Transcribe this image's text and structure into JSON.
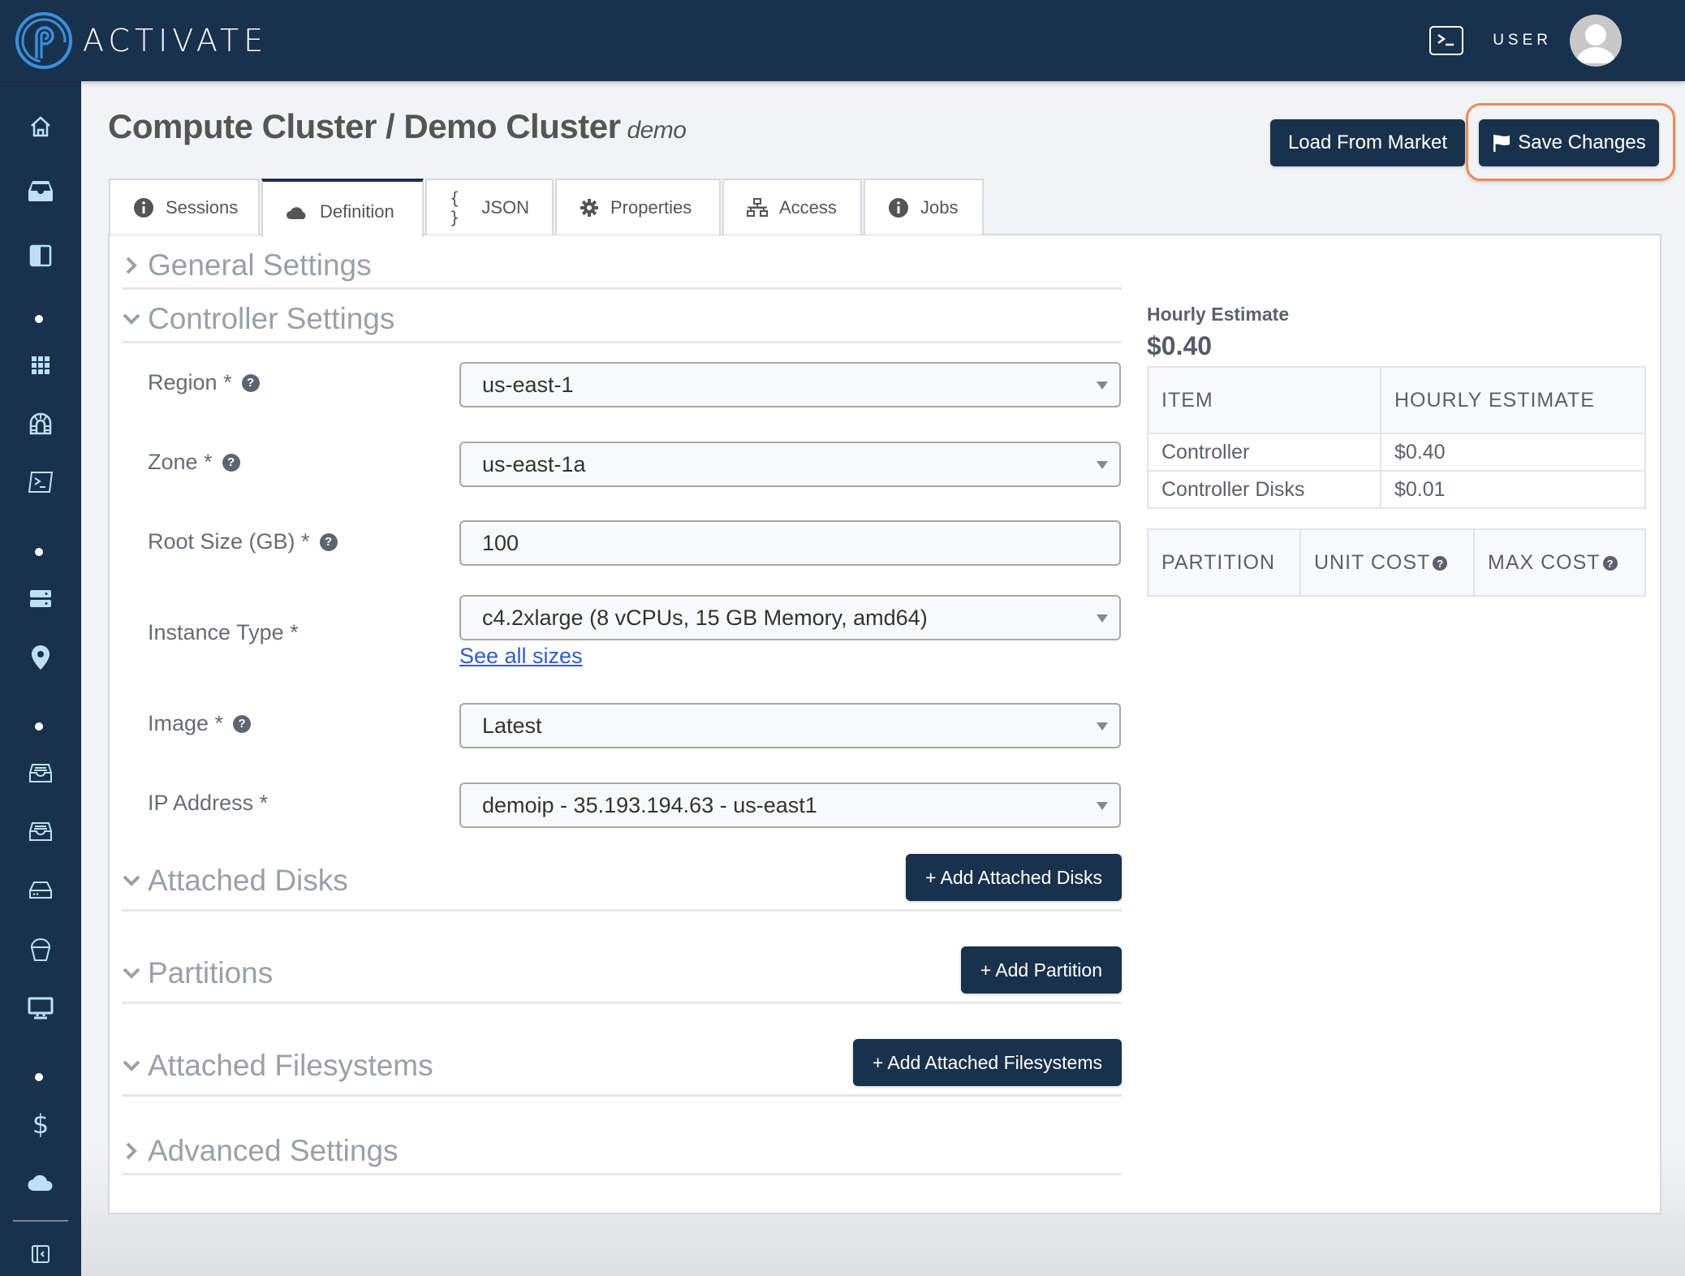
{
  "header": {
    "brand": "ACTIVATE",
    "user_label": "USER",
    "icons": {
      "terminal": "terminal-icon",
      "avatar": "user-avatar-icon"
    }
  },
  "sidebar": {
    "items": [
      {
        "name": "home",
        "icon": "home-icon"
      },
      {
        "name": "inbox",
        "icon": "inbox-icon"
      },
      {
        "name": "layout",
        "icon": "split-panel-icon"
      },
      {
        "name": "apps",
        "icon": "grid-icon"
      },
      {
        "name": "network",
        "icon": "network-tunnel-icon"
      },
      {
        "name": "terminal",
        "icon": "terminal-icon"
      },
      {
        "name": "servers",
        "icon": "server-icon"
      },
      {
        "name": "location",
        "icon": "map-pin-icon"
      },
      {
        "name": "storage-1",
        "icon": "archive-tray-icon"
      },
      {
        "name": "storage-2",
        "icon": "archive-tray-icon"
      },
      {
        "name": "disk",
        "icon": "hard-drive-icon"
      },
      {
        "name": "bucket",
        "icon": "bucket-icon"
      },
      {
        "name": "desktop",
        "icon": "monitor-icon"
      },
      {
        "name": "billing",
        "icon": "dollar-icon"
      },
      {
        "name": "cloud",
        "icon": "cloud-icon"
      },
      {
        "name": "collapse",
        "icon": "collapse-sidebar-icon"
      }
    ]
  },
  "page": {
    "title": "Compute Cluster / Demo Cluster",
    "subtitle": "demo"
  },
  "actions": {
    "load_from_market": "Load From Market",
    "save_changes": "Save Changes"
  },
  "tabs": [
    {
      "label": "Sessions",
      "icon": "info-icon",
      "active": false
    },
    {
      "label": "Definition",
      "icon": "cloud-icon",
      "active": true
    },
    {
      "label": "JSON",
      "icon": "braces-icon",
      "active": false
    },
    {
      "label": "Properties",
      "icon": "gear-icon",
      "active": false
    },
    {
      "label": "Access",
      "icon": "network-icon",
      "active": false
    },
    {
      "label": "Jobs",
      "icon": "info-icon",
      "active": false
    }
  ],
  "sections": {
    "general": {
      "title": "General Settings",
      "expanded": false
    },
    "controller": {
      "title": "Controller Settings",
      "expanded": true
    },
    "attached_disks": {
      "title": "Attached Disks",
      "expanded": true,
      "button": "+ Add Attached Disks"
    },
    "partitions": {
      "title": "Partitions",
      "expanded": true,
      "button": "+ Add Partition"
    },
    "filesystems": {
      "title": "Attached Filesystems",
      "expanded": true,
      "button": "+ Add Attached Filesystems"
    },
    "advanced": {
      "title": "Advanced Settings",
      "expanded": false
    }
  },
  "form": {
    "region": {
      "label": "Region *",
      "value": "us-east-1",
      "type": "select",
      "help": true
    },
    "zone": {
      "label": "Zone *",
      "value": "us-east-1a",
      "type": "select",
      "help": true
    },
    "root_size": {
      "label": "Root Size (GB) *",
      "value": "100",
      "type": "input",
      "help": true
    },
    "instance_type": {
      "label": "Instance Type *",
      "value": "c4.2xlarge (8 vCPUs, 15 GB Memory, amd64)",
      "type": "select",
      "help": false,
      "link": "See all sizes"
    },
    "image": {
      "label": "Image *",
      "value": "Latest",
      "type": "select",
      "help": true
    },
    "ip_address": {
      "label": "IP Address *",
      "value": "demoip - 35.193.194.63 - us-east1",
      "type": "select",
      "help": false
    }
  },
  "estimate": {
    "label": "Hourly Estimate",
    "total": "$0.40",
    "items_table": {
      "columns": [
        "ITEM",
        "HOURLY ESTIMATE"
      ],
      "rows": [
        [
          "Controller",
          "$0.40"
        ],
        [
          "Controller Disks",
          "$0.01"
        ]
      ]
    },
    "partition_table": {
      "columns": [
        "PARTITION",
        "UNIT COST",
        "MAX COST"
      ],
      "rows": []
    }
  },
  "colors": {
    "brand_navy": "#18324d",
    "highlight_orange": "#ec8b56",
    "link_blue": "#2f5bd4",
    "logo_blue": "#3b8fdc"
  }
}
